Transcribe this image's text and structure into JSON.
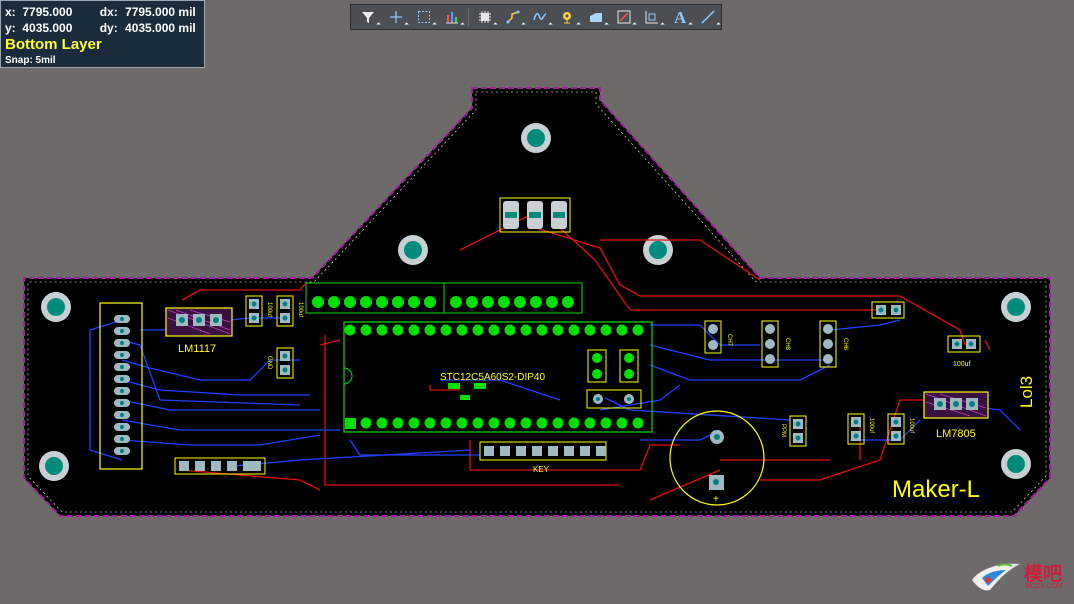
{
  "coords": {
    "x_label": "x:",
    "x_value": "7795.000",
    "dx_label": "dx:",
    "dx_value": "7795.000 mil",
    "y_label": "y:",
    "y_value": "4035.000",
    "dy_label": "dy:",
    "dy_value": "4035.000 mil",
    "layer": "Bottom Layer",
    "snap": "Snap: 5mil"
  },
  "toolbar": {
    "tools": [
      {
        "name": "filter-tool",
        "icon": "filter-icon"
      },
      {
        "name": "cross-probe-tool",
        "icon": "plus-icon"
      },
      {
        "name": "select-tool",
        "icon": "dotted-rect-icon"
      },
      {
        "name": "align-tool",
        "icon": "bar-chart-icon"
      },
      {
        "name": "component-tool",
        "icon": "chip-icon"
      },
      {
        "name": "route-tool",
        "icon": "route-icon"
      },
      {
        "name": "diff-pair-tool",
        "icon": "wave-icon"
      },
      {
        "name": "via-tool",
        "icon": "via-icon"
      },
      {
        "name": "polygon-tool",
        "icon": "polygon-icon"
      },
      {
        "name": "keepout-tool",
        "icon": "keepout-icon"
      },
      {
        "name": "dimension-tool",
        "icon": "dimension-icon"
      },
      {
        "name": "string-tool",
        "icon": "text-icon"
      },
      {
        "name": "line-tool",
        "icon": "line-icon"
      }
    ],
    "string_tool_glyph": "A"
  },
  "pcb": {
    "colors": {
      "board": "#000000",
      "board_edge": "#a020a0",
      "silkscreen": "#ffff00",
      "top_trace": "#e01010",
      "bottom_trace": "#2040ff",
      "pad_top": "#00e000",
      "pad_multi": "#a0b8c0",
      "hole": "#008080"
    },
    "labels": {
      "mcu": "STC12C5A60S2-DIP40",
      "lm1117": "LM1117",
      "lm7805": "LM7805",
      "key": "KEY",
      "maker": "Maker-L",
      "lol": "Lol3",
      "cap_100uf_right": "100uf",
      "cap_100uf_a": "100uf",
      "cap_100uf_b": "100uf",
      "cap_100uf_left": "100uf",
      "small_a": "100uf",
      "ch7": "CH7",
      "ch8": "CH8",
      "ch6": "CH6",
      "ppm": "PPM",
      "gnd": "GND"
    }
  },
  "watermark": {
    "text": "模吧",
    "sub": "MOZ8.COM"
  }
}
